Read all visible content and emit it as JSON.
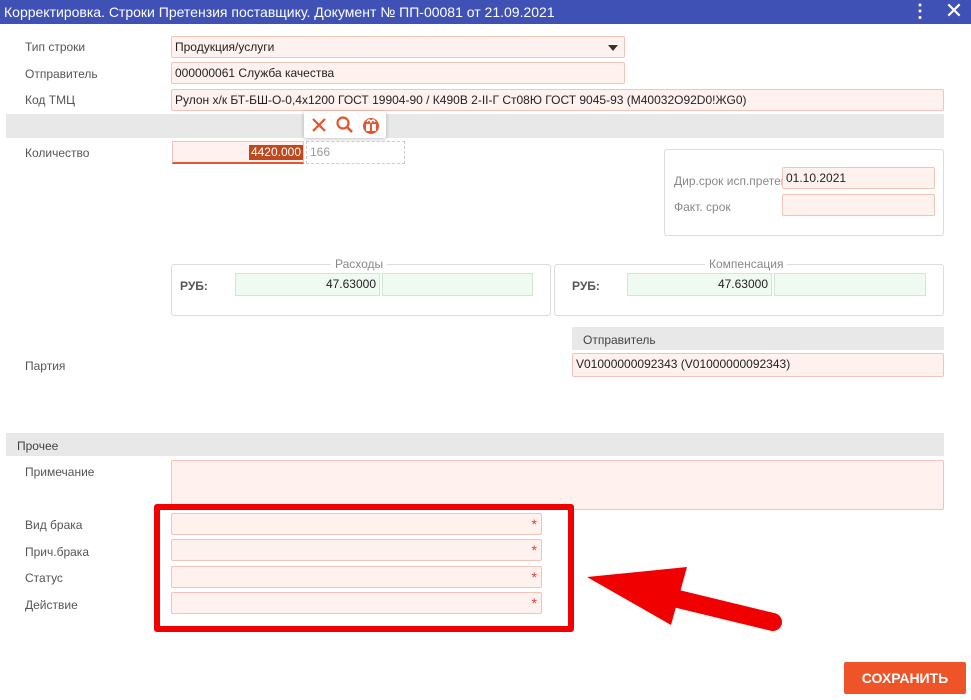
{
  "window": {
    "title": "Корректировка. Строки Претензия поставщику. Документ № ПП-00081 от 21.09.2021",
    "menu_icon": "more-vert-icon",
    "close_icon": "close-icon"
  },
  "form": {
    "row_type": {
      "label": "Тип строки",
      "value": "Продукция/услуги"
    },
    "sender": {
      "label": "Отправитель",
      "value": "000000061 Служба качества"
    },
    "tmc_code": {
      "label": "Код ТМЦ",
      "value": "Рулон х/к БТ-БШ-О-0,4х1200 ГОСТ 19904-90 / К490В 2-II-Г Ст08Ю ГОСТ 9045-93 (М40032О92D0!ЖG0)"
    },
    "quantity": {
      "label": "Количество",
      "value": "4420.000",
      "extra": "166"
    },
    "tools": {
      "clear_icon": "close-icon",
      "search_icon": "search-icon",
      "gift_icon": "gift-icon"
    },
    "deadlines": {
      "dir_label": "Дир.срок исп.претенз.",
      "dir_value": "01.10.2021",
      "fact_label": "Факт. срок",
      "fact_value": ""
    },
    "expenses": {
      "legend": "Расходы",
      "currency": "РУБ:",
      "value": "47.63000",
      "extra": ""
    },
    "compensation": {
      "legend": "Компенсация",
      "currency": "РУБ:",
      "value": "47.63000",
      "extra": ""
    },
    "sender_section": {
      "title": "Отправитель"
    },
    "batch": {
      "label": "Партия",
      "value": "V01000000092343 (V01000000092343)"
    }
  },
  "other": {
    "title": "Прочее",
    "note": {
      "label": "Примечание",
      "value": ""
    },
    "defect_type": {
      "label": "Вид брака",
      "value": ""
    },
    "defect_reason": {
      "label": "Прич.брака",
      "value": ""
    },
    "status": {
      "label": "Статус",
      "value": ""
    },
    "action": {
      "label": "Действие",
      "value": ""
    },
    "required_mark": "*"
  },
  "buttons": {
    "save": "СОХРАНИТЬ"
  },
  "colors": {
    "title_bar": "#3f51b5",
    "accent": "#ee5428",
    "highlight_frame": "#f00000"
  }
}
